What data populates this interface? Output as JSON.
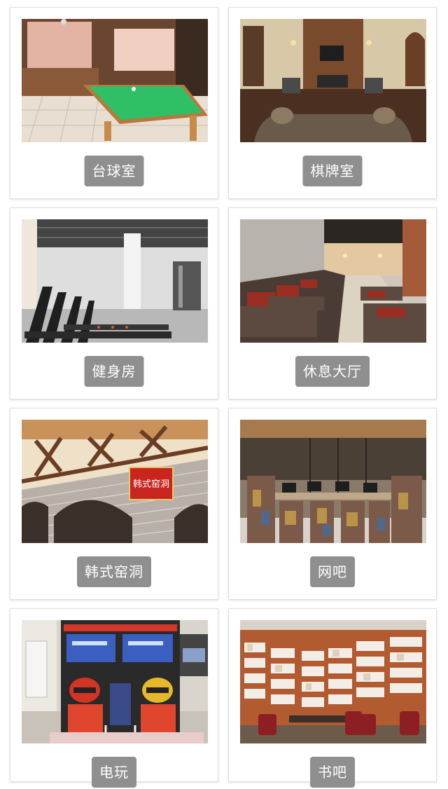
{
  "facilities": [
    {
      "label": "台球室",
      "photo": "billiards-room-photo"
    },
    {
      "label": "棋牌室",
      "photo": "chess-card-room-photo"
    },
    {
      "label": "健身房",
      "photo": "gym-photo"
    },
    {
      "label": "休息大厅",
      "photo": "lounge-hall-photo"
    },
    {
      "label": "韩式窑洞",
      "photo": "korean-cave-photo",
      "sign_text": "韩式窑洞"
    },
    {
      "label": "网吧",
      "photo": "internet-cafe-photo"
    },
    {
      "label": "电玩",
      "photo": "arcade-photo"
    },
    {
      "label": "书吧",
      "photo": "book-bar-photo"
    }
  ],
  "colors": {
    "label_bg": "#8f8f8f",
    "label_text": "#ffffff",
    "card_border": "#e1e1e1"
  }
}
